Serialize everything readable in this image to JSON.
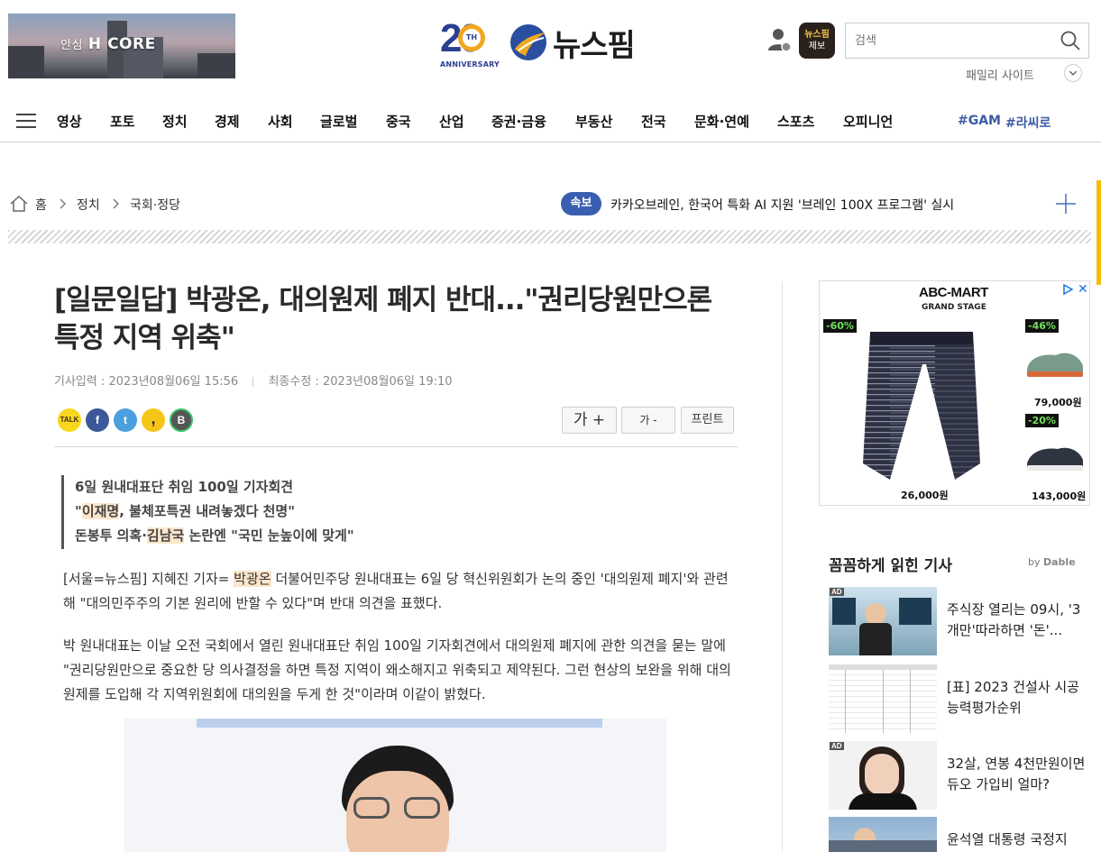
{
  "header": {
    "top_ad_small": "안심",
    "top_ad_brand": "H CORE",
    "anniversary_number": "20",
    "anniversary_th": "TH",
    "anniversary_label": "ANNIVERSARY",
    "site_name": "뉴스핌",
    "tip_badge_line1": "뉴스핌",
    "tip_badge_line2": "제보",
    "search_placeholder": "검색",
    "family_sites_label": "패밀리 사이트"
  },
  "nav": {
    "items": [
      "영상",
      "포토",
      "정치",
      "경제",
      "사회",
      "글로벌",
      "중국",
      "산업",
      "증권·금융",
      "부동산",
      "전국",
      "문화·연예",
      "스포츠",
      "오피니언"
    ],
    "tags": [
      "#GAM",
      "#라씨로"
    ]
  },
  "breadcrumb": {
    "items": [
      "홈",
      "정치",
      "국회·정당"
    ]
  },
  "breaking": {
    "badge": "속보",
    "text": "카카오브레인, 한국어 특화 AI 지원 '브레인 100X 프로그램' 실시"
  },
  "article": {
    "title": "[일문일답] 박광온, 대의원제 폐지 반대...\"권리당원만으론 특정 지역 위축\"",
    "published_label": "기사입력 :",
    "published": "2023년08월06일 15:56",
    "updated_label": "최종수정 :",
    "updated": "2023년08월06일 19:10",
    "share": {
      "kakaotalk": "TALK",
      "facebook": "f",
      "twitter": "t",
      "kakaostory": ",",
      "band": "B"
    },
    "tools": {
      "font_up": "가 +",
      "font_down": "가 -",
      "print": "프린트"
    },
    "subhead": {
      "line1": "6일 원내대표단 취임 100일 기자회견",
      "line2_pre": "\"",
      "line2_name": "이재명",
      "line2_post": ", 불체포특권 내려놓겠다 천명\"",
      "line3_pre": "돈봉투 의혹·",
      "line3_name": "김남국",
      "line3_post": " 논란엔 \"국민 눈높이에 맞게\""
    },
    "para1_pre": "[서울=뉴스핌] 지혜진 기자= ",
    "para1_name": "박광온",
    "para1_post": " 더불어민주당 원내대표는 6일 당 혁신위원회가 논의 중인 '대의원제 폐지'와 관련해 \"대의민주주의 기본 원리에 반할 수 있다\"며 반대 의견을 표했다.",
    "para2": "박 원내대표는 이날 오전 국회에서 열린 원내대표단 취임 100일 기자회견에서 대의원제 폐지에 관한 의견을 묻는 말에 \"권리당원만으로 중요한 당 의사결정을 하면 특정 지역이 왜소해지고 위축되고 제약된다. 그런 현상의 보완을 위해 대의원제를 도입해 각 지역위원회에 대의원을 두게 한 것\"이라며 이같이 밝혔다."
  },
  "sidebar": {
    "ad": {
      "brand": "ABC-MART",
      "sub": "GRAND STAGE",
      "products": [
        {
          "discount": "-60%",
          "price": "26,000원"
        },
        {
          "discount": "-46%",
          "price": "79,000원"
        },
        {
          "discount": "-20%",
          "price": "143,000원"
        }
      ]
    },
    "popular_title": "꼼꼼하게 읽힌 기사",
    "dable_by": "by",
    "dable_brand": "Dable",
    "popular": [
      {
        "ad": "AD",
        "text": "주식장 열리는 09시, '3개만'따라하면 '돈'..."
      },
      {
        "ad": "",
        "text": "[표] 2023 건설사 시공능력평가순위"
      },
      {
        "ad": "AD",
        "text": "32살, 연봉 4천만원이면 듀오 가입비 얼마?"
      },
      {
        "ad": "",
        "text": "윤석열 대통령 국정지"
      }
    ]
  },
  "colors": {
    "brand_navy": "#2a3f8f",
    "anniversary_gold": "#f0a820",
    "breaking_blue": "#3a5fb0",
    "tag_blue": "#3b5aa5",
    "highlight": "#fde6cc"
  }
}
